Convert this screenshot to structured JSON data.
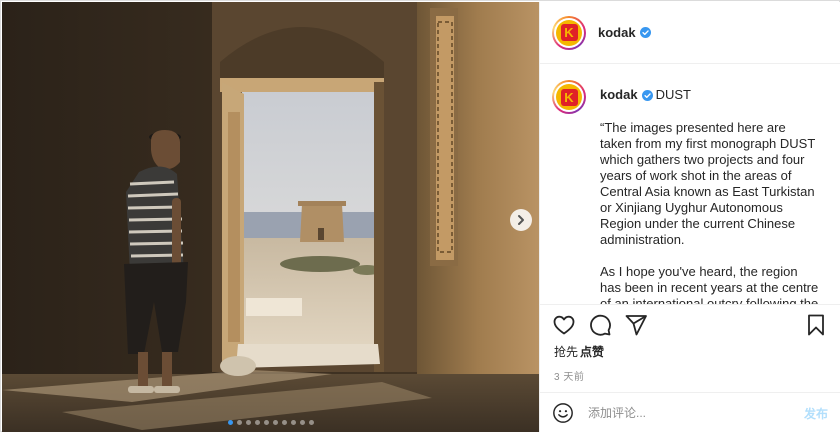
{
  "post": {
    "account": {
      "username": "kodak",
      "verified": true,
      "avatar_icon": "kodak-logo-icon"
    },
    "caption": {
      "username": "kodak",
      "title": "DUST",
      "paragraphs": [
        "“The images presented here are taken from my first monograph DUST which gathers two projects and four years of work shot in the areas of Central Asia known as East Turkistan or Xinjiang Uyghur Autonomous Region under the current Chinese administration.",
        "As I hope you've heard, the region has been in recent years at the centre of an international outcry following the"
      ]
    },
    "actions": {
      "like_icon": "heart-icon",
      "comment_icon": "comment-icon",
      "share_icon": "share-icon",
      "save_icon": "bookmark-icon"
    },
    "likes": {
      "prefix": "抢先",
      "action": "点赞"
    },
    "timestamp": "3 天前",
    "comment_box": {
      "emoji_icon": "emoji-icon",
      "placeholder": "添加评论...",
      "publish_label": "发布"
    },
    "carousel": {
      "total_slides": 10,
      "current_slide": 1,
      "next_icon": "chevron-right-icon"
    },
    "colors": {
      "accent": "#3897f0",
      "publish_disabled": "#b2dffc",
      "verified": "#3897f0",
      "kodak_yellow": "#f5b700",
      "kodak_red": "#e02127"
    }
  }
}
